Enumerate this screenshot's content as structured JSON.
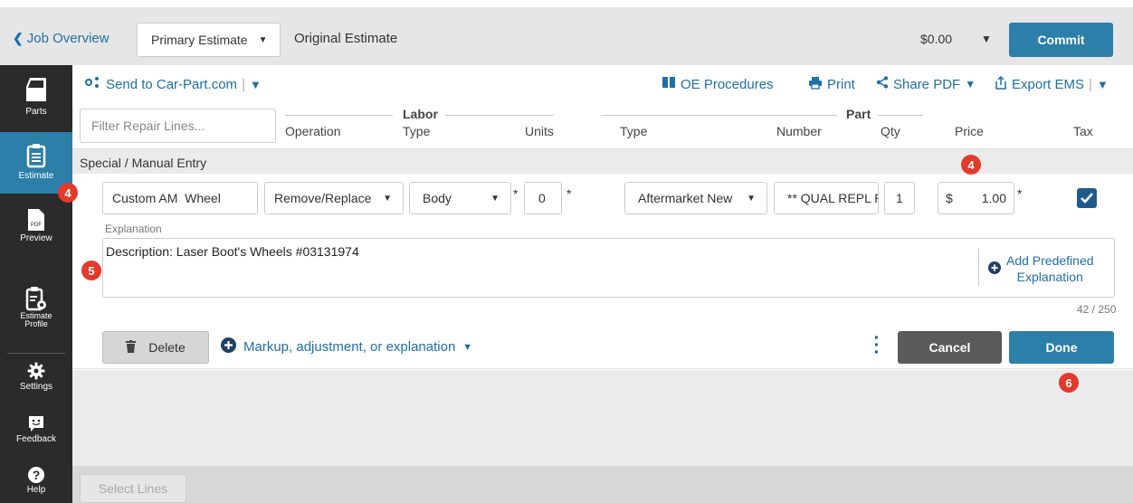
{
  "header": {
    "back_label": "Job Overview",
    "estimate_select": "Primary Estimate",
    "estimate_title": "Original Estimate",
    "total": "$0.00",
    "commit_label": "Commit"
  },
  "sidebar": {
    "items": [
      {
        "label": "Parts",
        "icon": "door-icon"
      },
      {
        "label": "Estimate",
        "icon": "clipboard-icon",
        "active": true
      },
      {
        "label": "Preview",
        "icon": "pdf-icon"
      },
      {
        "label": "Estimate Profile",
        "label_line1": "Estimate",
        "label_line2": "Profile",
        "icon": "clipboard-gear-icon"
      },
      {
        "label": "Settings",
        "icon": "gear-icon"
      },
      {
        "label": "Feedback",
        "icon": "smiley-chat-icon"
      },
      {
        "label": "Help",
        "icon": "help-icon"
      }
    ]
  },
  "toolbar": {
    "send_car_part": "Send to Car-Part.com",
    "oe_procedures": "OE Procedures",
    "print": "Print",
    "share_pdf": "Share PDF",
    "export_ems": "Export EMS"
  },
  "filter": {
    "placeholder": "Filter Repair Lines..."
  },
  "columns": {
    "operation": "Operation",
    "labor_group": "Labor",
    "labor_type": "Type",
    "units": "Units",
    "part_group": "Part",
    "part_type": "Type",
    "number": "Number",
    "qty": "Qty",
    "price": "Price",
    "tax": "Tax"
  },
  "section": {
    "title": "Special / Manual Entry"
  },
  "line": {
    "description": "Custom AM  Wheel",
    "operation": "Remove/Replace",
    "labor_type": "Body",
    "units": "0",
    "part_type": "Aftermarket New",
    "part_number": "** QUAL REPL P",
    "qty": "1",
    "currency": "$",
    "price": "1.00",
    "required_mark": "*",
    "tax_checked": true
  },
  "explanation": {
    "label": "Explanation",
    "text": "Description: Laser Boot's Wheels #03131974",
    "add_predefined_line1": "Add Predefined",
    "add_predefined_line2": "Explanation",
    "char_count": "42 / 250"
  },
  "actions": {
    "delete": "Delete",
    "markup": "Markup, adjustment, or explanation",
    "cancel": "Cancel",
    "done": "Done",
    "select_lines": "Select Lines"
  },
  "badges": {
    "estimate": "4",
    "price": "4",
    "explanation": "5",
    "done": "6"
  },
  "colors": {
    "primary": "#2b7fa8",
    "link": "#1f6fa6",
    "sidebar": "#2b2b2b",
    "badge": "#e23a2b",
    "cancel": "#5a5a5a"
  }
}
